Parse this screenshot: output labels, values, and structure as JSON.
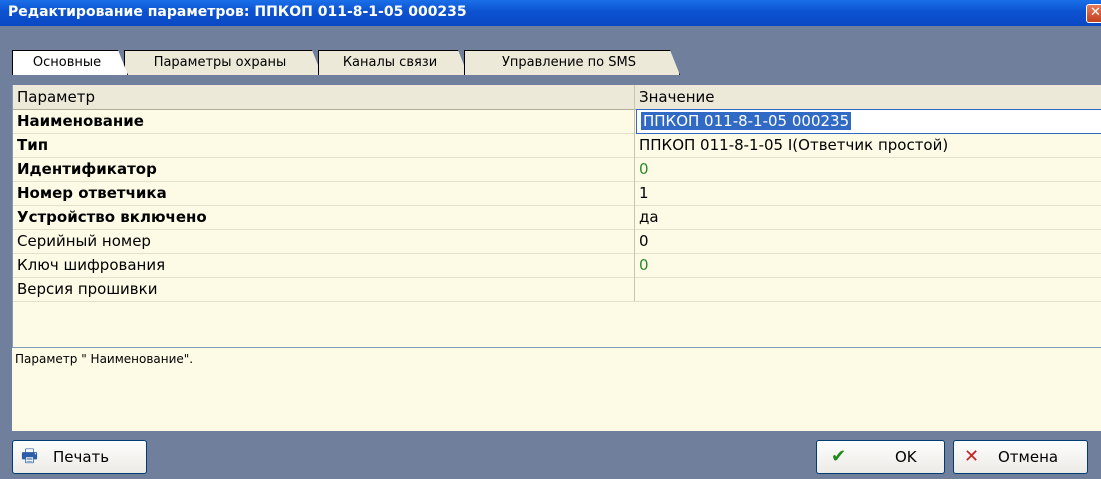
{
  "window": {
    "title": "Редактирование параметров: ППКОП 011-8-1-05 000235",
    "close_glyph": "✕"
  },
  "tabs": [
    {
      "label": "Основные",
      "active": true
    },
    {
      "label": "Параметры охраны",
      "active": false
    },
    {
      "label": "Каналы связи",
      "active": false
    },
    {
      "label": "Управление по SMS",
      "active": false
    }
  ],
  "grid": {
    "headers": {
      "param": "Параметр",
      "value": "Значение"
    },
    "rows": [
      {
        "param": "Наименование",
        "value": "ППКОП 011-8-1-05 000235"
      },
      {
        "param": "Тип",
        "value": "ППКОП 011-8-1-05 I(Ответчик простой)"
      },
      {
        "param": "Идентификатор",
        "value": "0"
      },
      {
        "param": "Номер ответчика",
        "value": "1"
      },
      {
        "param": "Устройство включено",
        "value": "да"
      },
      {
        "param": "Серийный номер",
        "value": "0"
      },
      {
        "param": "Ключ шифрования",
        "value": "0"
      },
      {
        "param": "Версия прошивки",
        "value": ""
      }
    ]
  },
  "description": "Параметр \" Наименование\".",
  "buttons": {
    "print": "Печать",
    "ok": "OK",
    "cancel": "Отмена"
  },
  "icons": {
    "print": "printer-icon",
    "ok": "checkmark-icon",
    "cancel": "x-icon"
  },
  "colors": {
    "title_bar": "#0c52d0",
    "selection": "#316ac5",
    "grid_background": "#fdfbe6",
    "green_value": "#2a8a2a"
  }
}
